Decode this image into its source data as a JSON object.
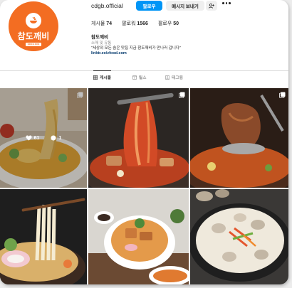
{
  "profile": {
    "username": "cdgb.official",
    "avatar_text": "참도깨비",
    "avatar_subtext": "SINCE 2004",
    "display_name": "참도깨비",
    "category": "소매 및 유통",
    "bio": "\"세상의 모든 숨은 맛집 지금 참도깨비가 만나러 갑니다\"",
    "link": "linktr.ee/zfood.com"
  },
  "buttons": {
    "follow": "팔로우",
    "message": "메시지 보내기"
  },
  "stats": {
    "posts_label": "게시물",
    "posts_value": "74",
    "followers_label": "팔로워",
    "followers_value": "1566",
    "following_label": "팔로우",
    "following_value": "50"
  },
  "tabs": {
    "posts": "게시물",
    "reels": "릴스",
    "tagged": "태그됨"
  },
  "hover": {
    "likes": "61",
    "comments": "1"
  },
  "icons": {
    "add_user": "add-user-icon",
    "more": "more-options-icon",
    "grid": "grid-icon",
    "reels": "reels-icon",
    "tagged": "tagged-icon",
    "multi": "multi-post-icon",
    "like": "heart-icon",
    "comment": "comment-icon"
  },
  "colors": {
    "brand": "#f36d22",
    "follow_button": "#0095f6",
    "link": "#00376b"
  }
}
